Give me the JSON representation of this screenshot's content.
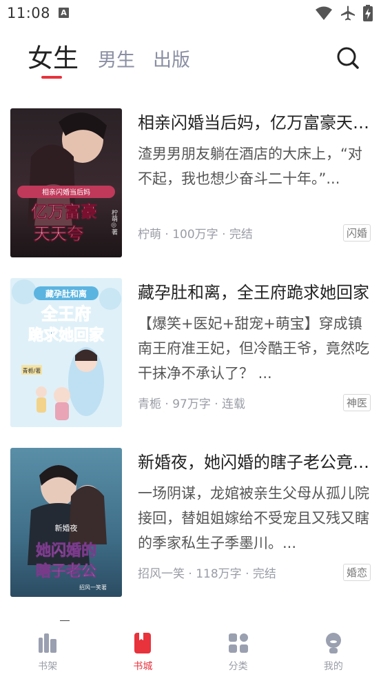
{
  "status_bar": {
    "time": "11:08",
    "notification_icon": "A",
    "icons": [
      "wifi-icon",
      "airplane-icon",
      "battery-charging-icon"
    ]
  },
  "top_tabs": [
    {
      "label": "女生",
      "active": true
    },
    {
      "label": "男生",
      "active": false
    },
    {
      "label": "出版",
      "active": false
    }
  ],
  "accent_color": "#e8323c",
  "books": [
    {
      "title": "相亲闪婚当后妈，亿万富豪天天夸",
      "description": "渣男男朋友躺在酒店的大床上，“对不起，我也想少奋斗二十年。”...",
      "meta": "柠萌 · 100万字 · 完结",
      "tag": "闪婚",
      "cover": {
        "top_text": "相亲闪婚当后妈",
        "main_text": "亿万富豪天天夸",
        "author_text": "柠萌◎著"
      }
    },
    {
      "title": "藏孕肚和离，全王府跪求她回家",
      "description": "【爆笑+医妃+甜宠+萌宝】穿成镇南王府准王妃，但冷酷王爷，竟然吃干抹净不承认了？ ...",
      "meta": "青栀 · 97万字 · 连载",
      "tag": "神医",
      "cover": {
        "top_text": "藏孕肚和离",
        "main_text": "全王府跪求她回家",
        "author_text": "青栀/著"
      }
    },
    {
      "title": "新婚夜，她闪婚的瞎子老公竟是首富",
      "description": "一场阴谋，龙婠被亲生父母从孤儿院接回，替姐姐嫁给不受宠且又残又瞎的季家私生子季墨川。...",
      "meta": "招风一笑 · 118万字 · 完结",
      "tag": "婚恋",
      "cover": {
        "top_text": "新婚夜",
        "main_text": "她闪婚的瞎子老公",
        "author_text": "招风一笑著"
      }
    }
  ],
  "bottom_nav": [
    {
      "label": "书架",
      "icon": "bookshelf-icon",
      "active": false
    },
    {
      "label": "书城",
      "icon": "bookstore-icon",
      "active": true
    },
    {
      "label": "分类",
      "icon": "category-icon",
      "active": false
    },
    {
      "label": "我的",
      "icon": "profile-icon",
      "active": false
    }
  ]
}
